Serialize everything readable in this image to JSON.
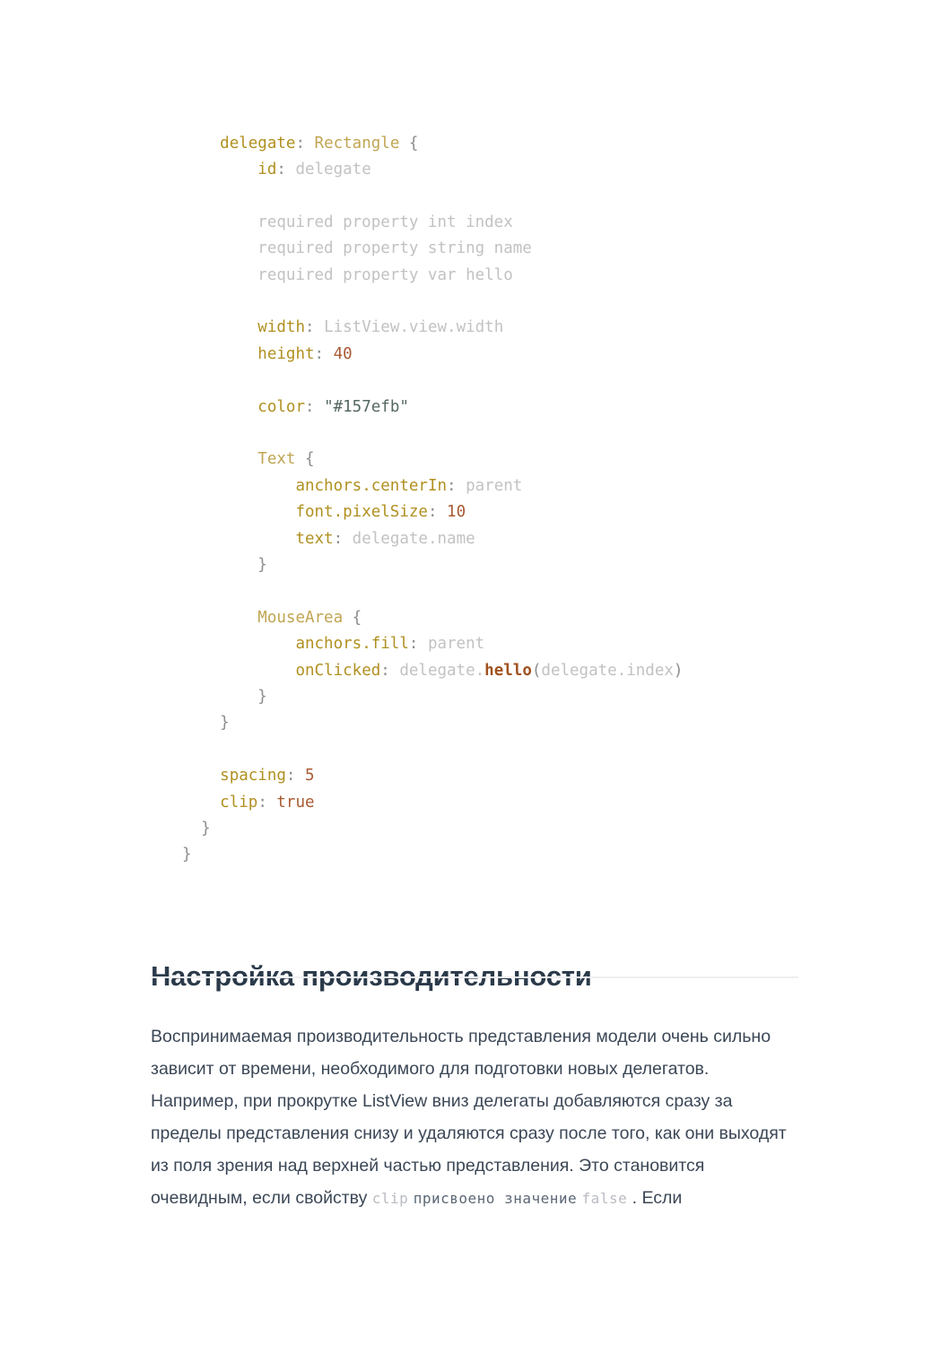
{
  "document": {
    "background_color": "#ffffff"
  },
  "code_block": {
    "language": "qml",
    "lines": [
      [
        {
          "text": "    ",
          "token": "plain"
        },
        {
          "text": "delegate",
          "token": "key"
        },
        {
          "text": ": ",
          "token": "punct"
        },
        {
          "text": "Rectangle",
          "token": "type"
        },
        {
          "text": " {",
          "token": "punct"
        }
      ],
      [
        {
          "text": "        ",
          "token": "plain"
        },
        {
          "text": "id",
          "token": "key"
        },
        {
          "text": ": ",
          "token": "punct"
        },
        {
          "text": "delegate",
          "token": "plain"
        }
      ],
      [],
      [
        {
          "text": "        required property int index",
          "token": "plain"
        }
      ],
      [
        {
          "text": "        required property string name",
          "token": "plain"
        }
      ],
      [
        {
          "text": "        required property var hello",
          "token": "plain"
        }
      ],
      [],
      [
        {
          "text": "        ",
          "token": "plain"
        },
        {
          "text": "width",
          "token": "key"
        },
        {
          "text": ": ",
          "token": "punct"
        },
        {
          "text": "ListView.view.width",
          "token": "plain"
        }
      ],
      [
        {
          "text": "        ",
          "token": "plain"
        },
        {
          "text": "height",
          "token": "key"
        },
        {
          "text": ": ",
          "token": "punct"
        },
        {
          "text": "40",
          "token": "num"
        }
      ],
      [],
      [
        {
          "text": "        ",
          "token": "plain"
        },
        {
          "text": "color",
          "token": "key"
        },
        {
          "text": ": ",
          "token": "punct"
        },
        {
          "text": "\"#157efb\"",
          "token": "str"
        }
      ],
      [],
      [
        {
          "text": "        ",
          "token": "plain"
        },
        {
          "text": "Text",
          "token": "type"
        },
        {
          "text": " {",
          "token": "punct"
        }
      ],
      [
        {
          "text": "            ",
          "token": "plain"
        },
        {
          "text": "anchors.centerIn",
          "token": "key"
        },
        {
          "text": ": ",
          "token": "punct"
        },
        {
          "text": "parent",
          "token": "plain"
        }
      ],
      [
        {
          "text": "            ",
          "token": "plain"
        },
        {
          "text": "font.pixelSize",
          "token": "key"
        },
        {
          "text": ": ",
          "token": "punct"
        },
        {
          "text": "10",
          "token": "num"
        }
      ],
      [
        {
          "text": "            ",
          "token": "plain"
        },
        {
          "text": "text",
          "token": "key"
        },
        {
          "text": ": ",
          "token": "punct"
        },
        {
          "text": "delegate.name",
          "token": "plain"
        }
      ],
      [
        {
          "text": "        }",
          "token": "punct"
        }
      ],
      [],
      [
        {
          "text": "        ",
          "token": "plain"
        },
        {
          "text": "MouseArea",
          "token": "type"
        },
        {
          "text": " {",
          "token": "punct"
        }
      ],
      [
        {
          "text": "            ",
          "token": "plain"
        },
        {
          "text": "anchors.fill",
          "token": "key"
        },
        {
          "text": ": ",
          "token": "punct"
        },
        {
          "text": "parent",
          "token": "plain"
        }
      ],
      [
        {
          "text": "            ",
          "token": "plain"
        },
        {
          "text": "onClicked",
          "token": "key"
        },
        {
          "text": ": ",
          "token": "punct"
        },
        {
          "text": "delegate.",
          "token": "plain"
        },
        {
          "text": "hello",
          "token": "fn"
        },
        {
          "text": "(",
          "token": "punct"
        },
        {
          "text": "delegate.index",
          "token": "plain"
        },
        {
          "text": ")",
          "token": "punct"
        }
      ],
      [
        {
          "text": "        }",
          "token": "punct"
        }
      ],
      [
        {
          "text": "    }",
          "token": "punct"
        }
      ],
      [],
      [
        {
          "text": "    ",
          "token": "plain"
        },
        {
          "text": "spacing",
          "token": "key"
        },
        {
          "text": ": ",
          "token": "punct"
        },
        {
          "text": "5",
          "token": "num"
        }
      ],
      [
        {
          "text": "    ",
          "token": "plain"
        },
        {
          "text": "clip",
          "token": "key"
        },
        {
          "text": ": ",
          "token": "punct"
        },
        {
          "text": "true",
          "token": "num"
        }
      ],
      [
        {
          "text": "  }",
          "token": "punct"
        }
      ],
      [
        {
          "text": "}",
          "token": "punct"
        }
      ]
    ]
  },
  "section": {
    "heading": "Настройка производительности",
    "heading_color": "#2b3a4a",
    "rule_color": "#eeeef2",
    "paragraph": [
      {
        "text": "Воспринимаемая производительность представления модели очень сильно зависит от времени, необходимого для подготовки новых делегатов. Например, при прокрутке ListView вниз делегаты добавляются сразу за пределы представления снизу и удаляются сразу после того, как они выходят из поля зрения над верхней частью представления. Это становится очевидным, если свойству ",
        "style": "normal"
      },
      {
        "text": "clip",
        "style": "code"
      },
      {
        "text": " ",
        "style": "normal"
      },
      {
        "text": "присвоено значение",
        "style": "mono-ru"
      },
      {
        "text": " ",
        "style": "normal"
      },
      {
        "text": "false",
        "style": "code"
      },
      {
        "text": " . Если",
        "style": "normal"
      }
    ]
  }
}
